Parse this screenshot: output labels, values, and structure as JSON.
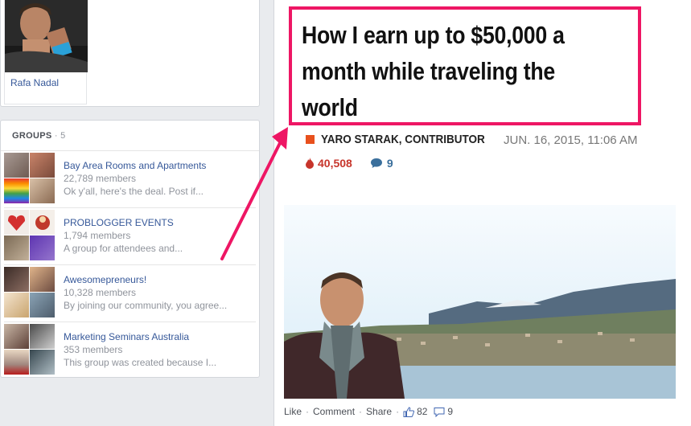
{
  "friend": {
    "name": "Rafa Nadal"
  },
  "groups": {
    "title": "GROUPS",
    "count": "· 5",
    "items": [
      {
        "name": "Bay Area Rooms and Apartments",
        "members": "22,789 members",
        "description": "Ok y'all, here's the deal. Post if..."
      },
      {
        "name": "PROBLOGGER EVENTS",
        "members": "1,794 members",
        "description": "A group for attendees and..."
      },
      {
        "name": "Awesomepreneurs!",
        "members": "10,328 members",
        "description": "By joining our community, you agree..."
      },
      {
        "name": "Marketing Seminars Australia",
        "members": "353 members",
        "description": "This group was created because I..."
      }
    ]
  },
  "post": {
    "headline": "How I earn up to $50,000 a month while traveling the world",
    "author": "YARO STARAK, CONTRIBUTOR",
    "date": "JUN. 16, 2015, 11:06 AM",
    "views": "40,508",
    "comments": "9",
    "actions": {
      "like": "Like",
      "comment": "Comment",
      "share": "Share",
      "like_count": "82",
      "comment_count": "9"
    }
  },
  "colors": {
    "highlight": "#ee1664",
    "link": "#365899",
    "views": "#c7352b",
    "comments": "#3a6f9c"
  }
}
